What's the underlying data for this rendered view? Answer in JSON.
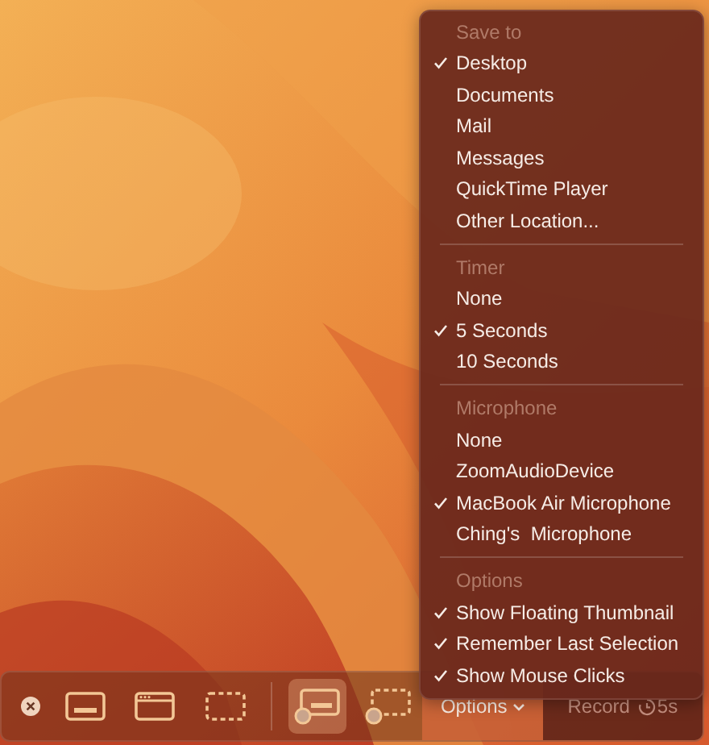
{
  "menu": {
    "sections": [
      {
        "header": "Save to",
        "items": [
          {
            "label": "Desktop",
            "checked": true
          },
          {
            "label": "Documents",
            "checked": false
          },
          {
            "label": "Mail",
            "checked": false
          },
          {
            "label": "Messages",
            "checked": false
          },
          {
            "label": "QuickTime Player",
            "checked": false
          },
          {
            "label": "Other Location...",
            "checked": false
          }
        ]
      },
      {
        "header": "Timer",
        "items": [
          {
            "label": "None",
            "checked": false
          },
          {
            "label": "5 Seconds",
            "checked": true
          },
          {
            "label": "10 Seconds",
            "checked": false
          }
        ]
      },
      {
        "header": "Microphone",
        "items": [
          {
            "label": "None",
            "checked": false
          },
          {
            "label": "ZoomAudioDevice",
            "checked": false
          },
          {
            "label": "MacBook Air Microphone",
            "checked": true
          },
          {
            "label": "Ching's  Microphone",
            "checked": false
          }
        ]
      },
      {
        "header": "Options",
        "items": [
          {
            "label": "Show Floating Thumbnail",
            "checked": true
          },
          {
            "label": "Remember Last Selection",
            "checked": true
          },
          {
            "label": "Show Mouse Clicks",
            "checked": true
          }
        ]
      }
    ]
  },
  "toolbar": {
    "tools": [
      {
        "kind": "close",
        "selected": false
      },
      {
        "kind": "capture-screen",
        "selected": false
      },
      {
        "kind": "capture-window",
        "selected": false
      },
      {
        "kind": "capture-selection",
        "selected": false
      },
      {
        "kind": "divider"
      },
      {
        "kind": "record-screen",
        "selected": true
      },
      {
        "kind": "record-selection",
        "selected": false
      }
    ],
    "options_label": "Options",
    "record_label": "Record",
    "timer_label": "5s"
  }
}
